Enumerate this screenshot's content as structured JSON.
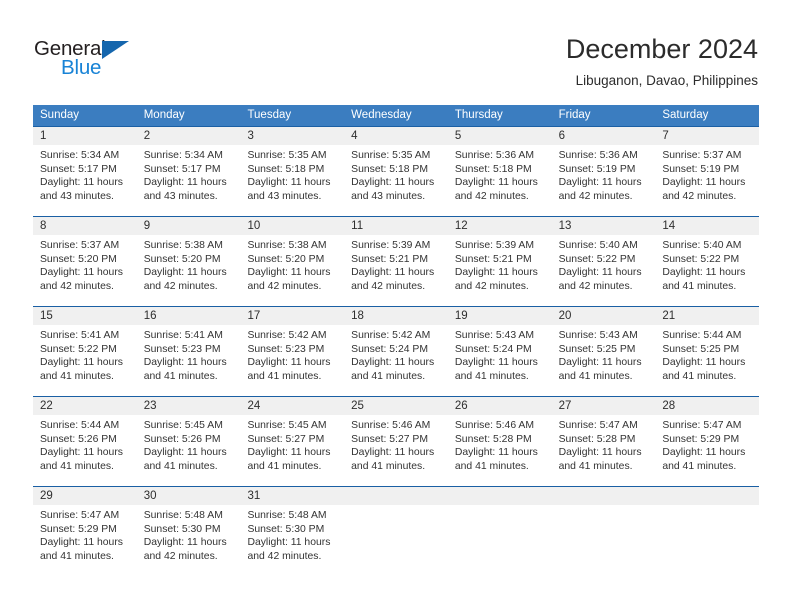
{
  "logo": {
    "text_top": "General",
    "text_bottom": "Blue",
    "triangle_color": "#1566ad",
    "blue_color": "#1883d6"
  },
  "header": {
    "title": "December 2024",
    "subtitle": "Libuganon, Davao, Philippines"
  },
  "theme": {
    "header_blue": "#3b7dc0",
    "rule_blue": "#1a5fa4",
    "daynum_bg": "#f0f0f0"
  },
  "weekdays": [
    "Sunday",
    "Monday",
    "Tuesday",
    "Wednesday",
    "Thursday",
    "Friday",
    "Saturday"
  ],
  "weeks": [
    {
      "days": [
        {
          "num": "1",
          "sunrise": "Sunrise: 5:34 AM",
          "sunset": "Sunset: 5:17 PM",
          "daylight1": "Daylight: 11 hours",
          "daylight2": "and 43 minutes."
        },
        {
          "num": "2",
          "sunrise": "Sunrise: 5:34 AM",
          "sunset": "Sunset: 5:17 PM",
          "daylight1": "Daylight: 11 hours",
          "daylight2": "and 43 minutes."
        },
        {
          "num": "3",
          "sunrise": "Sunrise: 5:35 AM",
          "sunset": "Sunset: 5:18 PM",
          "daylight1": "Daylight: 11 hours",
          "daylight2": "and 43 minutes."
        },
        {
          "num": "4",
          "sunrise": "Sunrise: 5:35 AM",
          "sunset": "Sunset: 5:18 PM",
          "daylight1": "Daylight: 11 hours",
          "daylight2": "and 43 minutes."
        },
        {
          "num": "5",
          "sunrise": "Sunrise: 5:36 AM",
          "sunset": "Sunset: 5:18 PM",
          "daylight1": "Daylight: 11 hours",
          "daylight2": "and 42 minutes."
        },
        {
          "num": "6",
          "sunrise": "Sunrise: 5:36 AM",
          "sunset": "Sunset: 5:19 PM",
          "daylight1": "Daylight: 11 hours",
          "daylight2": "and 42 minutes."
        },
        {
          "num": "7",
          "sunrise": "Sunrise: 5:37 AM",
          "sunset": "Sunset: 5:19 PM",
          "daylight1": "Daylight: 11 hours",
          "daylight2": "and 42 minutes."
        }
      ]
    },
    {
      "days": [
        {
          "num": "8",
          "sunrise": "Sunrise: 5:37 AM",
          "sunset": "Sunset: 5:20 PM",
          "daylight1": "Daylight: 11 hours",
          "daylight2": "and 42 minutes."
        },
        {
          "num": "9",
          "sunrise": "Sunrise: 5:38 AM",
          "sunset": "Sunset: 5:20 PM",
          "daylight1": "Daylight: 11 hours",
          "daylight2": "and 42 minutes."
        },
        {
          "num": "10",
          "sunrise": "Sunrise: 5:38 AM",
          "sunset": "Sunset: 5:20 PM",
          "daylight1": "Daylight: 11 hours",
          "daylight2": "and 42 minutes."
        },
        {
          "num": "11",
          "sunrise": "Sunrise: 5:39 AM",
          "sunset": "Sunset: 5:21 PM",
          "daylight1": "Daylight: 11 hours",
          "daylight2": "and 42 minutes."
        },
        {
          "num": "12",
          "sunrise": "Sunrise: 5:39 AM",
          "sunset": "Sunset: 5:21 PM",
          "daylight1": "Daylight: 11 hours",
          "daylight2": "and 42 minutes."
        },
        {
          "num": "13",
          "sunrise": "Sunrise: 5:40 AM",
          "sunset": "Sunset: 5:22 PM",
          "daylight1": "Daylight: 11 hours",
          "daylight2": "and 42 minutes."
        },
        {
          "num": "14",
          "sunrise": "Sunrise: 5:40 AM",
          "sunset": "Sunset: 5:22 PM",
          "daylight1": "Daylight: 11 hours",
          "daylight2": "and 41 minutes."
        }
      ]
    },
    {
      "days": [
        {
          "num": "15",
          "sunrise": "Sunrise: 5:41 AM",
          "sunset": "Sunset: 5:22 PM",
          "daylight1": "Daylight: 11 hours",
          "daylight2": "and 41 minutes."
        },
        {
          "num": "16",
          "sunrise": "Sunrise: 5:41 AM",
          "sunset": "Sunset: 5:23 PM",
          "daylight1": "Daylight: 11 hours",
          "daylight2": "and 41 minutes."
        },
        {
          "num": "17",
          "sunrise": "Sunrise: 5:42 AM",
          "sunset": "Sunset: 5:23 PM",
          "daylight1": "Daylight: 11 hours",
          "daylight2": "and 41 minutes."
        },
        {
          "num": "18",
          "sunrise": "Sunrise: 5:42 AM",
          "sunset": "Sunset: 5:24 PM",
          "daylight1": "Daylight: 11 hours",
          "daylight2": "and 41 minutes."
        },
        {
          "num": "19",
          "sunrise": "Sunrise: 5:43 AM",
          "sunset": "Sunset: 5:24 PM",
          "daylight1": "Daylight: 11 hours",
          "daylight2": "and 41 minutes."
        },
        {
          "num": "20",
          "sunrise": "Sunrise: 5:43 AM",
          "sunset": "Sunset: 5:25 PM",
          "daylight1": "Daylight: 11 hours",
          "daylight2": "and 41 minutes."
        },
        {
          "num": "21",
          "sunrise": "Sunrise: 5:44 AM",
          "sunset": "Sunset: 5:25 PM",
          "daylight1": "Daylight: 11 hours",
          "daylight2": "and 41 minutes."
        }
      ]
    },
    {
      "days": [
        {
          "num": "22",
          "sunrise": "Sunrise: 5:44 AM",
          "sunset": "Sunset: 5:26 PM",
          "daylight1": "Daylight: 11 hours",
          "daylight2": "and 41 minutes."
        },
        {
          "num": "23",
          "sunrise": "Sunrise: 5:45 AM",
          "sunset": "Sunset: 5:26 PM",
          "daylight1": "Daylight: 11 hours",
          "daylight2": "and 41 minutes."
        },
        {
          "num": "24",
          "sunrise": "Sunrise: 5:45 AM",
          "sunset": "Sunset: 5:27 PM",
          "daylight1": "Daylight: 11 hours",
          "daylight2": "and 41 minutes."
        },
        {
          "num": "25",
          "sunrise": "Sunrise: 5:46 AM",
          "sunset": "Sunset: 5:27 PM",
          "daylight1": "Daylight: 11 hours",
          "daylight2": "and 41 minutes."
        },
        {
          "num": "26",
          "sunrise": "Sunrise: 5:46 AM",
          "sunset": "Sunset: 5:28 PM",
          "daylight1": "Daylight: 11 hours",
          "daylight2": "and 41 minutes."
        },
        {
          "num": "27",
          "sunrise": "Sunrise: 5:47 AM",
          "sunset": "Sunset: 5:28 PM",
          "daylight1": "Daylight: 11 hours",
          "daylight2": "and 41 minutes."
        },
        {
          "num": "28",
          "sunrise": "Sunrise: 5:47 AM",
          "sunset": "Sunset: 5:29 PM",
          "daylight1": "Daylight: 11 hours",
          "daylight2": "and 41 minutes."
        }
      ]
    },
    {
      "days": [
        {
          "num": "29",
          "sunrise": "Sunrise: 5:47 AM",
          "sunset": "Sunset: 5:29 PM",
          "daylight1": "Daylight: 11 hours",
          "daylight2": "and 41 minutes."
        },
        {
          "num": "30",
          "sunrise": "Sunrise: 5:48 AM",
          "sunset": "Sunset: 5:30 PM",
          "daylight1": "Daylight: 11 hours",
          "daylight2": "and 42 minutes."
        },
        {
          "num": "31",
          "sunrise": "Sunrise: 5:48 AM",
          "sunset": "Sunset: 5:30 PM",
          "daylight1": "Daylight: 11 hours",
          "daylight2": "and 42 minutes."
        },
        {
          "num": "",
          "sunrise": "",
          "sunset": "",
          "daylight1": "",
          "daylight2": ""
        },
        {
          "num": "",
          "sunrise": "",
          "sunset": "",
          "daylight1": "",
          "daylight2": ""
        },
        {
          "num": "",
          "sunrise": "",
          "sunset": "",
          "daylight1": "",
          "daylight2": ""
        },
        {
          "num": "",
          "sunrise": "",
          "sunset": "",
          "daylight1": "",
          "daylight2": ""
        }
      ]
    }
  ]
}
